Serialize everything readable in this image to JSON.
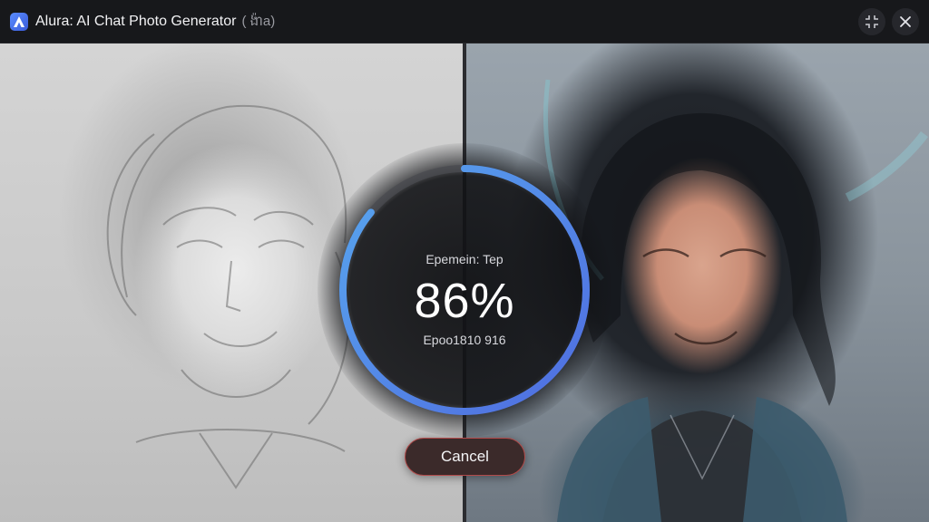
{
  "window": {
    "title": "Alura: AI Chat Photo Generator",
    "title_suffix": "( ង៉ាa)"
  },
  "titlebar_buttons": {
    "shrink_icon": "shrink-icon",
    "close_icon": "close-icon"
  },
  "progress": {
    "stage_label": "Epemein: Tep",
    "percent_text": "86%",
    "value": 0.86,
    "sub_label": "Epoo1810 916"
  },
  "actions": {
    "cancel_label": "Cancel"
  },
  "colors": {
    "ring_start": "#4f6ce0",
    "ring_end": "#58a6ee",
    "ring_track": "#4a4b50",
    "cancel_border": "#b24a4a"
  }
}
